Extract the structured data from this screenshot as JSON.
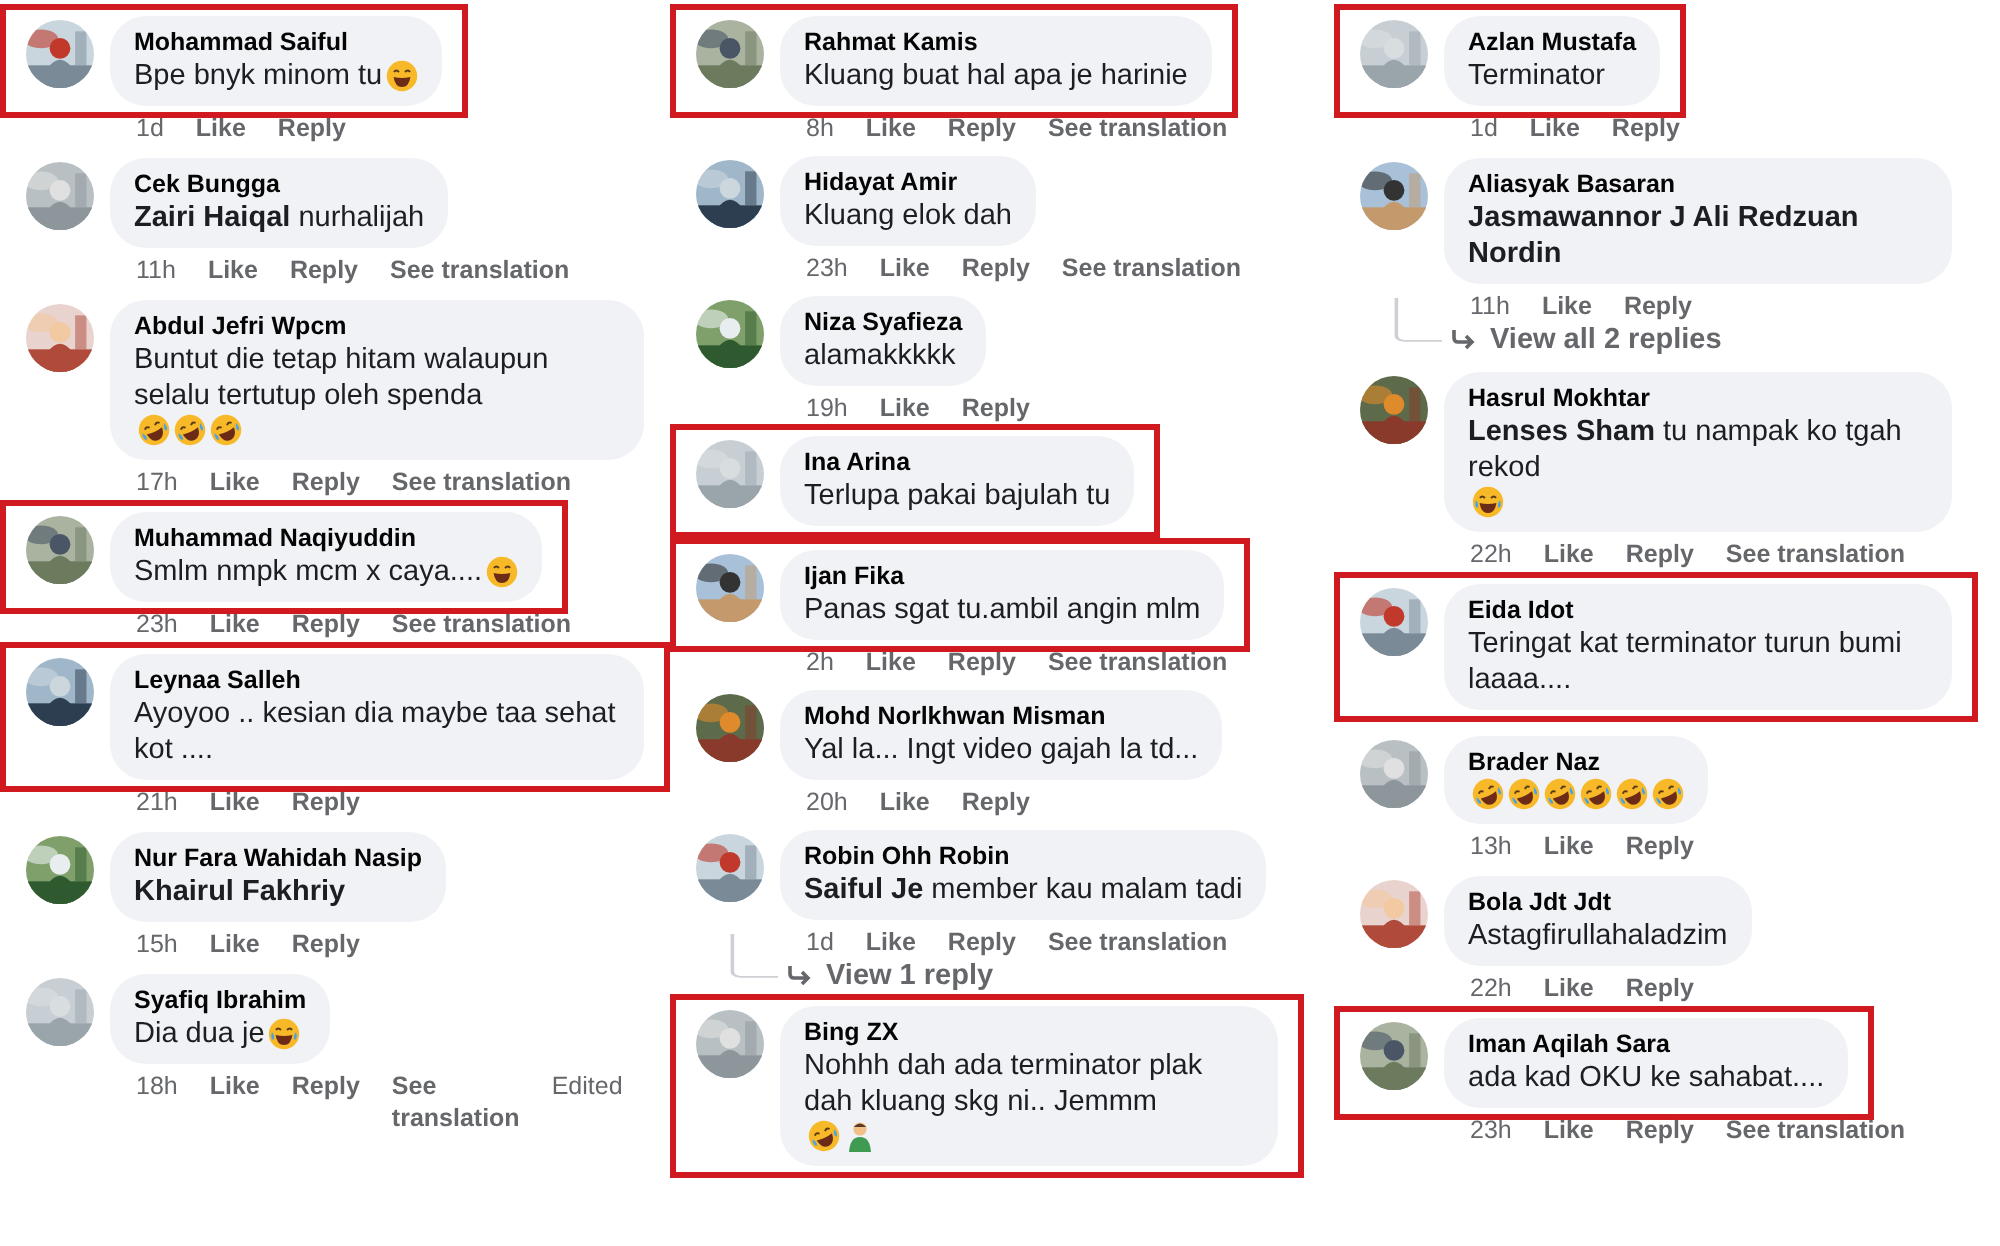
{
  "columns": [
    {
      "comments": [
        {
          "name": "Mohammad Saiful",
          "text": "Bpe bnyk minom tu",
          "emojis": [
            {
              "kind": "grin"
            }
          ],
          "time": "1d",
          "actions": [
            "Like",
            "Reply"
          ],
          "highlighted": true
        },
        {
          "name": "Cek Bungga",
          "text": "**Zairi Haiqal** nurhalijah",
          "time": "11h",
          "actions": [
            "Like",
            "Reply",
            "See translation"
          ],
          "highlighted": false
        },
        {
          "name": "Abdul Jefri Wpcm",
          "text": "Buntut die tetap hitam walaupun selalu tertutup oleh spenda",
          "emojis": [
            {
              "kind": "rofl"
            },
            {
              "kind": "rofl"
            },
            {
              "kind": "rofl"
            }
          ],
          "time": "17h",
          "actions": [
            "Like",
            "Reply",
            "See translation"
          ],
          "highlighted": false
        },
        {
          "name": "Muhammad Naqiyuddin",
          "text": "Smlm nmpk mcm x caya....",
          "emojis": [
            {
              "kind": "grin"
            }
          ],
          "time": "23h",
          "actions": [
            "Like",
            "Reply",
            "See translation"
          ],
          "highlighted": true
        },
        {
          "name": "Leynaa Salleh",
          "text": "Ayoyoo .. kesian dia maybe taa sehat kot ....",
          "time": "21h",
          "actions": [
            "Like",
            "Reply"
          ],
          "highlighted": true
        },
        {
          "name": "Nur Fara Wahidah Nasip",
          "text": "Khairul Fakhriy",
          "tag_only": true,
          "time": "15h",
          "actions": [
            "Like",
            "Reply"
          ],
          "highlighted": false
        },
        {
          "name": "Syafiq Ibrahim",
          "text": "Dia dua je",
          "emojis": [
            {
              "kind": "joy"
            }
          ],
          "time": "18h",
          "actions": [
            "Like",
            "Reply",
            "See translation"
          ],
          "edited": "Edited",
          "highlighted": false
        }
      ]
    },
    {
      "comments": [
        {
          "name": "Rahmat Kamis",
          "text": "Kluang buat hal apa je harinie",
          "time": "8h",
          "actions": [
            "Like",
            "Reply",
            "See translation"
          ],
          "highlighted": true
        },
        {
          "name": "Hidayat Amir",
          "text": "Kluang elok dah",
          "time": "23h",
          "actions": [
            "Like",
            "Reply",
            "See translation"
          ],
          "highlighted": false
        },
        {
          "name": "Niza Syafieza",
          "text": "alamakkkkk",
          "time": "19h",
          "actions": [
            "Like",
            "Reply"
          ],
          "highlighted": false
        },
        {
          "name": "Ina Arina",
          "text": "Terlupa pakai bajulah tu",
          "highlighted": true
        },
        {
          "name": "Ijan Fika",
          "text": "Panas sgat tu.ambil angin mlm",
          "time": "2h",
          "actions": [
            "Like",
            "Reply",
            "See translation"
          ],
          "highlighted": true
        },
        {
          "name": "Mohd Norlkhwan Misman",
          "text": "Yal la... Ingt video gajah la td...",
          "time": "20h",
          "actions": [
            "Like",
            "Reply"
          ],
          "highlighted": false
        },
        {
          "name": "Robin Ohh Robin",
          "text": "**Saiful Je** member kau malam tadi",
          "time": "1d",
          "actions": [
            "Like",
            "Reply",
            "See translation"
          ],
          "replies": "View 1 reply",
          "highlighted": false
        },
        {
          "name": "Bing ZX",
          "text": "Nohhh dah ada terminator plak dah kluang skg ni.. Jemmm",
          "emojis": [
            {
              "kind": "rofl"
            },
            {
              "kind": "man"
            }
          ],
          "highlighted": true
        }
      ]
    },
    {
      "comments": [
        {
          "name": "Azlan Mustafa",
          "text": "Terminator",
          "time": "1d",
          "actions": [
            "Like",
            "Reply"
          ],
          "highlighted": true
        },
        {
          "name": "Aliasyak Basaran",
          "text": "Jasmawannor J Ali Redzuan Nordin",
          "tag_only": true,
          "time": "11h",
          "actions": [
            "Like",
            "Reply"
          ],
          "replies": "View all 2 replies",
          "highlighted": false
        },
        {
          "name": "Hasrul Mokhtar",
          "text": "**Lenses Sham** tu nampak ko tgah rekod",
          "emojis": [
            {
              "kind": "joy"
            }
          ],
          "time": "22h",
          "actions": [
            "Like",
            "Reply",
            "See translation"
          ],
          "highlighted": false
        },
        {
          "name": "Eida Idot",
          "text": "Teringat kat terminator turun bumi laaaa....",
          "highlighted": true
        },
        {
          "name": "Brader Naz",
          "emojis": [
            {
              "kind": "rofl"
            },
            {
              "kind": "rofl"
            },
            {
              "kind": "rofl"
            },
            {
              "kind": "rofl"
            },
            {
              "kind": "rofl"
            },
            {
              "kind": "rofl"
            }
          ],
          "time": "13h",
          "actions": [
            "Like",
            "Reply"
          ],
          "highlighted": false
        },
        {
          "name": "Bola Jdt Jdt",
          "text": "Astagfirullahaladzim",
          "time": "22h",
          "actions": [
            "Like",
            "Reply"
          ],
          "highlighted": false
        },
        {
          "name": "Iman Aqilah Sara",
          "text": "ada kad OKU ke sahabat....",
          "time": "23h",
          "actions": [
            "Like",
            "Reply",
            "See translation"
          ],
          "highlighted": true
        }
      ]
    }
  ]
}
